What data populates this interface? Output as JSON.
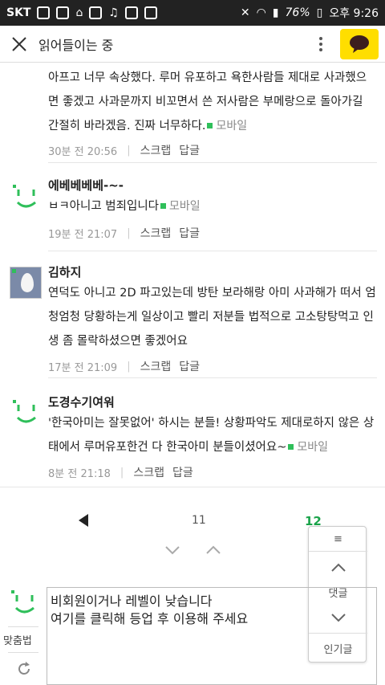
{
  "statusbar": {
    "carrier": "SKT",
    "battery": "76%",
    "time": "오후 9:26"
  },
  "appbar": {
    "title": "읽어들이는 중"
  },
  "comments": [
    {
      "text": "아프고 너무 속상했다. 루머 유포하고 욕한사람들 제대로 사과했으면 좋겠고 사과문까지 비꼬면서 쓴 저사람은 부메랑으로 돌아가길 간절히 바라겠음. 진짜 너무하다.",
      "mobile": "모바일",
      "time": "30분 전 20:56",
      "scrap": "스크랩",
      "reply": "답글"
    },
    {
      "author": "에베베베베-~-",
      "text": "ㅂㅋ아니고 범죄입니다",
      "mobile": "모바일",
      "time": "19분 전 21:07",
      "scrap": "스크랩",
      "reply": "답글"
    },
    {
      "author": "김하지",
      "text": "연덕도 아니고 2D 파고있는데 방탄 보라해랑 아미 사과해가 떠서 엄청엄청 당황하는게 일상이고 빨리 저분들 법적으로 고소탕탕먹고 인생 좀 몰락하셨으면 좋겠어요",
      "time": "17분 전 21:09",
      "scrap": "스크랩",
      "reply": "답글"
    },
    {
      "author": "도경수기여워",
      "text": "'한국아미는 잘못없어' 하시는 분들! 상황파악도 제대로하지 않은 상태에서 루머유포한건 다 한국아미 분들이셨어요~",
      "mobile": "모바일",
      "time": "8분 전 21:18",
      "scrap": "스크랩",
      "reply": "답글"
    }
  ],
  "pagination": {
    "pages": [
      "11",
      "12"
    ],
    "current": "12"
  },
  "float_panel": {
    "menu": "≡",
    "comments": "댓글",
    "popular": "인기글"
  },
  "write": {
    "spell_check": "맞춤법",
    "notice_line1": "비회원이거나 레벨이 낮습니다",
    "notice_line2": "여기를 클릭해 등업 후 이용해 주세요"
  },
  "colors": {
    "accent_green": "#2fbf5a",
    "current_page": "#1aa34a",
    "kakao_yellow": "#ffde00",
    "statusbar": "#222222"
  }
}
